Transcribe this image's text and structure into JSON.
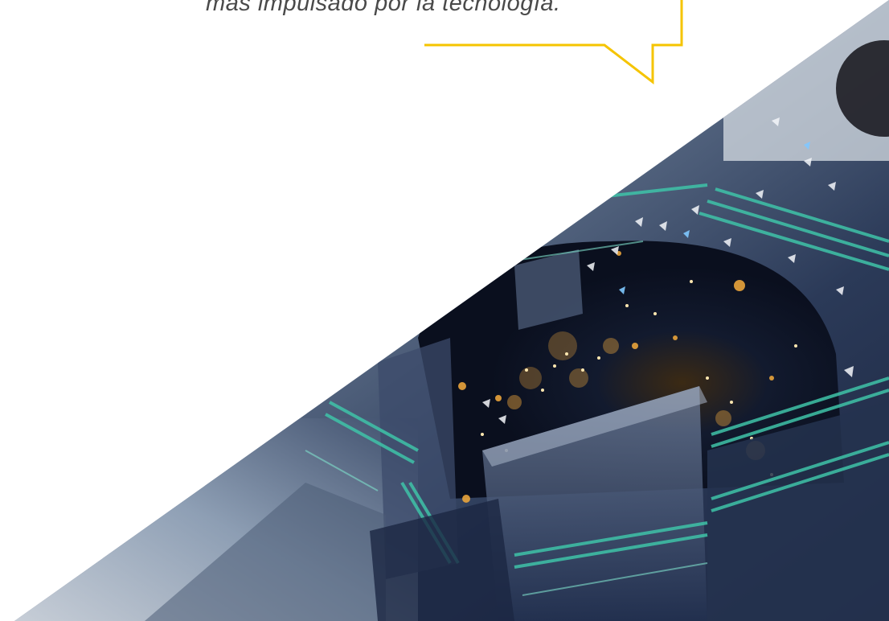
{
  "quote": {
    "text": "más impulsado por la tecnología."
  },
  "colors": {
    "accent": "#f5c400",
    "quote_text": "#4a4a4a",
    "background": "#ffffff",
    "teal_glow": "#3fc3a8",
    "city_lights": "#e9a43b",
    "glass_dark": "#1f2a44"
  },
  "hero": {
    "icon": "tech-cityscape-image"
  }
}
